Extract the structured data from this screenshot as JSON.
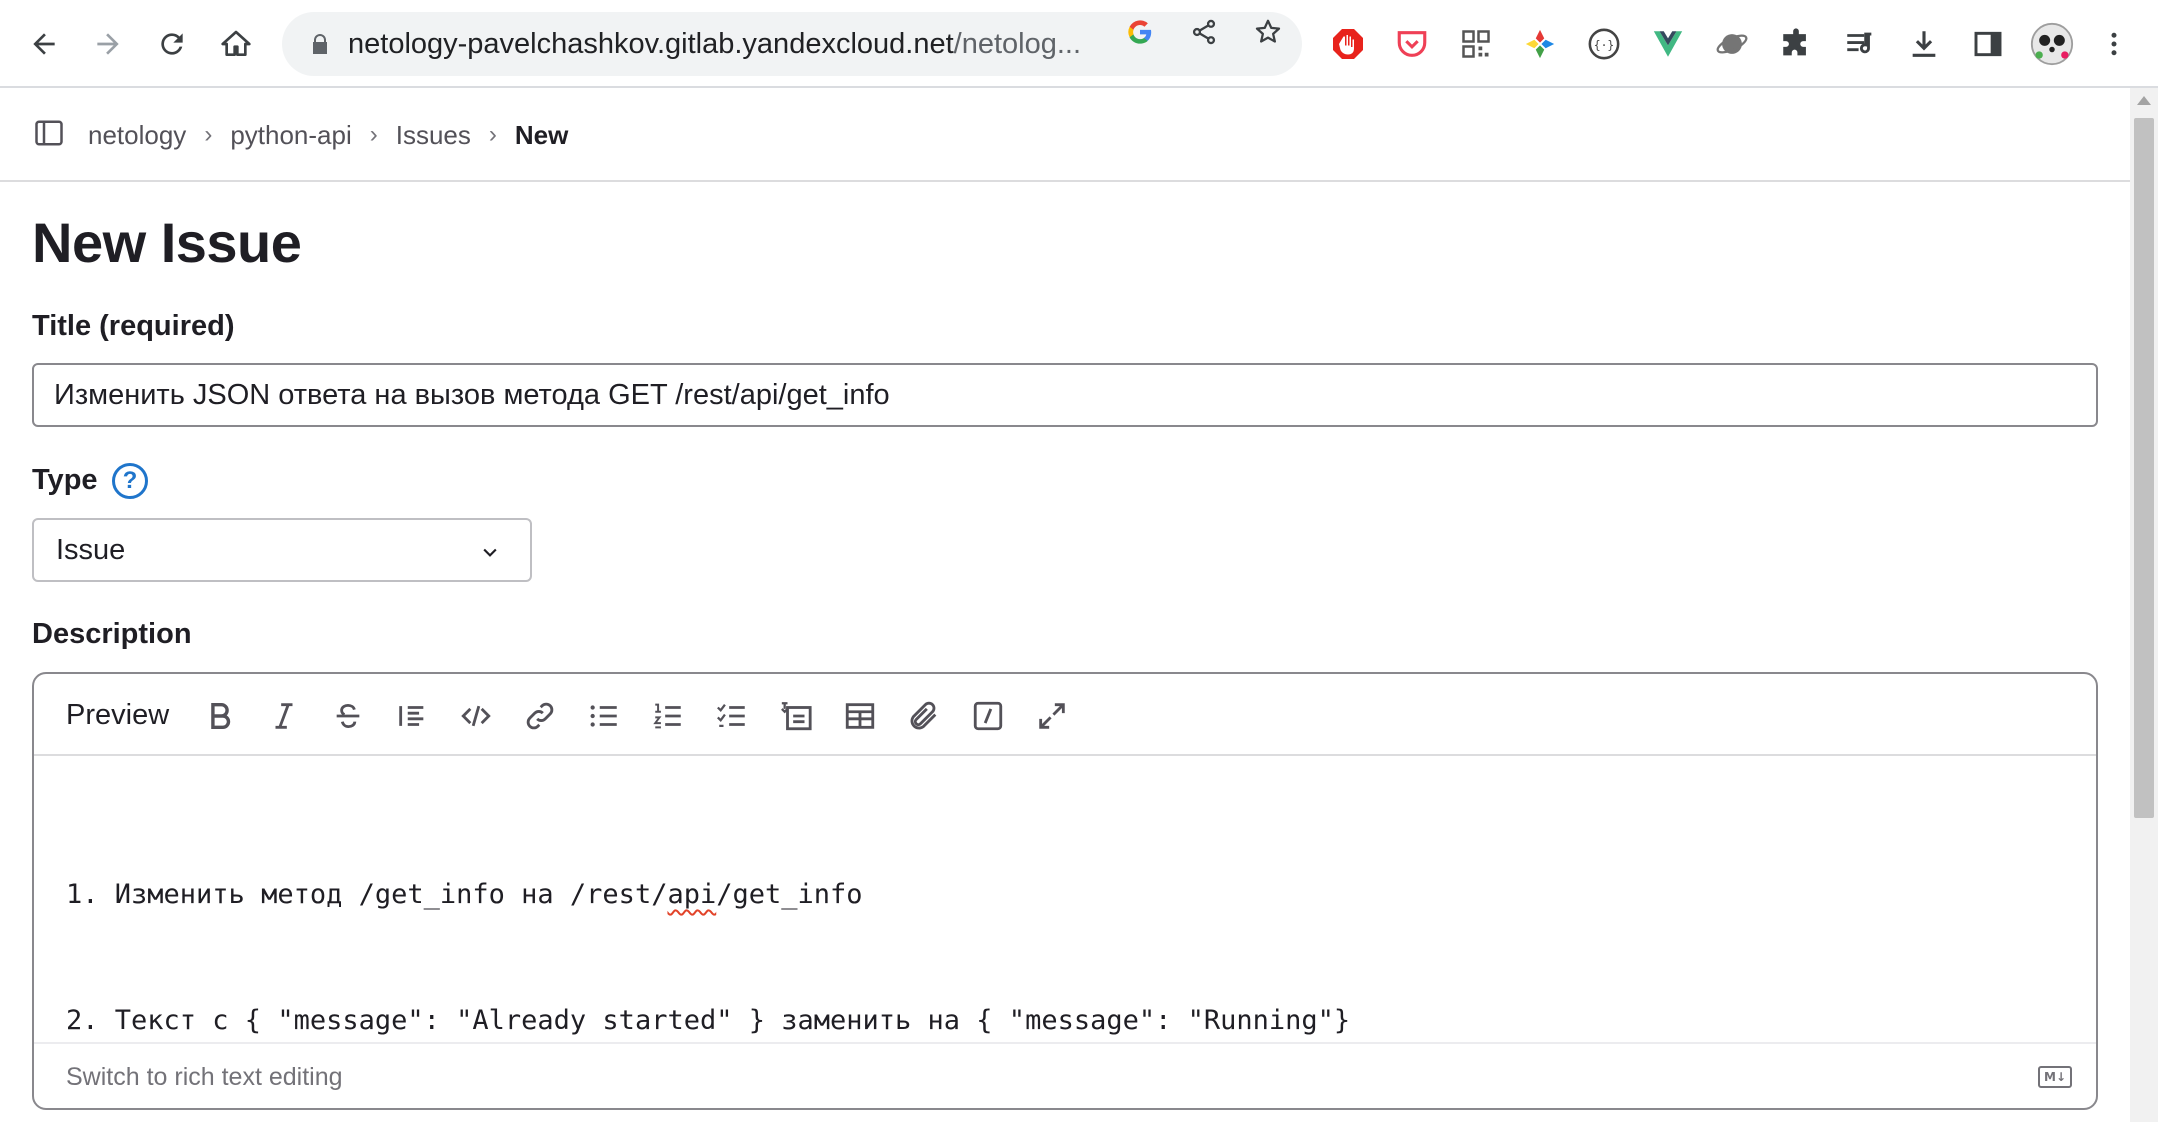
{
  "browser": {
    "url_main": "netology-pavelchashkov.gitlab.yandexcloud.net",
    "url_rest": "/netolog...",
    "icons": [
      "back-icon",
      "forward-icon",
      "reload-icon",
      "home-icon",
      "lock-icon",
      "google-icon",
      "share-icon",
      "star-icon",
      "stop-extension-icon",
      "pocket-icon",
      "qr-icon",
      "colorful-extension-icon",
      "json-extension-icon",
      "vue-icon",
      "planet-icon",
      "puzzle-icon",
      "reading-list-icon",
      "download-icon",
      "side-panel-icon",
      "profile-avatar",
      "more-icon"
    ]
  },
  "breadcrumb": {
    "items": [
      "netology",
      "python-api",
      "Issues"
    ],
    "current": "New",
    "separator": "›"
  },
  "page": {
    "title": "New Issue"
  },
  "form": {
    "title_label": "Title (required)",
    "title_value": "Изменить JSON ответа на вызов метода GET /rest/api/get_info",
    "type_label": "Type",
    "type_help": "?",
    "type_value": "Issue",
    "description_label": "Description"
  },
  "editor": {
    "preview_label": "Preview",
    "toolbar_icons": [
      "bold-icon",
      "italic-icon",
      "strikethrough-icon",
      "quote-icon",
      "code-icon",
      "link-icon",
      "bullet-list-icon",
      "numbered-list-icon",
      "task-list-icon",
      "collapsible-icon",
      "table-icon",
      "attachment-icon",
      "quick-actions-icon",
      "fullscreen-icon"
    ],
    "lines": [
      {
        "before": "1. Изменить метод /get_info на /rest/",
        "spell": "api",
        "after": "/get_info"
      },
      {
        "before": "2. Текст с { \"message\": \"Already started\" } заменить на { \"message\": \"Running\"}",
        "spell": "",
        "after": ""
      }
    ],
    "footer_switch": "Switch to rich text editing",
    "markdown_badge": "M↓"
  },
  "colors": {
    "link_blue": "#1f75cb",
    "text_dark": "#1f1e24",
    "border": "#89888d"
  }
}
